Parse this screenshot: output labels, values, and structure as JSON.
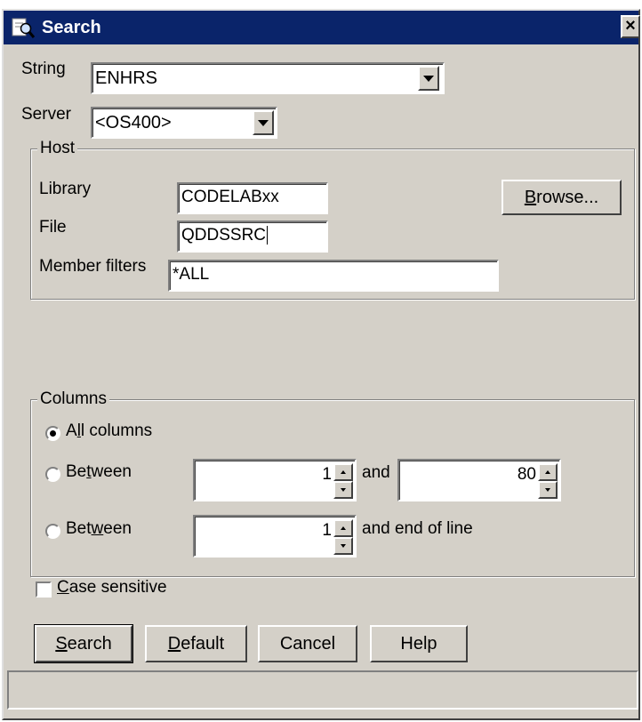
{
  "window": {
    "title": "Search",
    "icon": "search-window-icon",
    "close_label": "×"
  },
  "search_string": {
    "label": "String",
    "value": "ENHRS"
  },
  "server": {
    "label": "Server",
    "value": "<OS400>"
  },
  "host": {
    "legend": "Host",
    "library_label": "Library",
    "library_value": "CODELABxx",
    "file_label": "File",
    "file_value": "QDDSSRC",
    "member_filters_label": "Member filters",
    "member_filters_value": "*ALL",
    "browse_prefix": "B",
    "browse_rest": "rowse..."
  },
  "columns": {
    "legend": "Columns",
    "all_columns_pre": "A",
    "all_columns_u": "l",
    "all_columns_post": "l columns",
    "between1_pre": "Be",
    "between1_u": "t",
    "between1_post": "ween",
    "between1_from": "1",
    "between1_and": "and",
    "between1_to": "80",
    "between2_pre": "Bet",
    "between2_u": "w",
    "between2_post": "een",
    "between2_from": "1",
    "between2_suffix": "and end of line",
    "selected": "All columns"
  },
  "case_sensitive": {
    "u": "C",
    "rest": "ase sensitive",
    "checked": false
  },
  "buttons": {
    "search_u": "S",
    "search_rest": "earch",
    "default_u": "D",
    "default_rest": "efault",
    "cancel": "Cancel",
    "help": "Help"
  },
  "status_text": ""
}
